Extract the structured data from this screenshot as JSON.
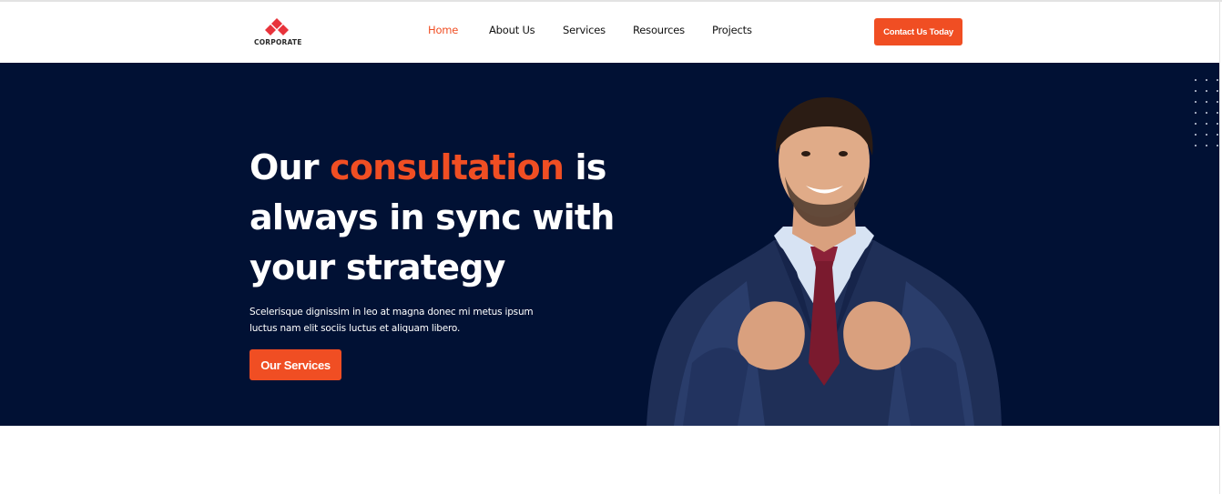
{
  "brand": {
    "name": "CORPORATE",
    "color": "#f04e23"
  },
  "nav": {
    "items": [
      {
        "label": "Home",
        "active": true
      },
      {
        "label": "About Us",
        "active": false
      },
      {
        "label": "Services",
        "active": false
      },
      {
        "label": "Resources",
        "active": false
      },
      {
        "label": "Projects",
        "active": false
      }
    ],
    "cta_label": "Contact Us Today"
  },
  "hero": {
    "title_part1": "Our ",
    "title_accent": "consultation",
    "title_part2": " is always in sync with your strategy",
    "description": "Scelerisque dignissim in leo at magna donec mi metus ipsum luctus nam elit sociis luctus et aliquam libero.",
    "button_label": "Our Services",
    "background_color": "#011134",
    "accent_color": "#f04e23",
    "image": "businessman-adjusting-jacket-photo"
  },
  "icons": [
    "logo-diamond-icon",
    "dot-grid-decoration"
  ]
}
